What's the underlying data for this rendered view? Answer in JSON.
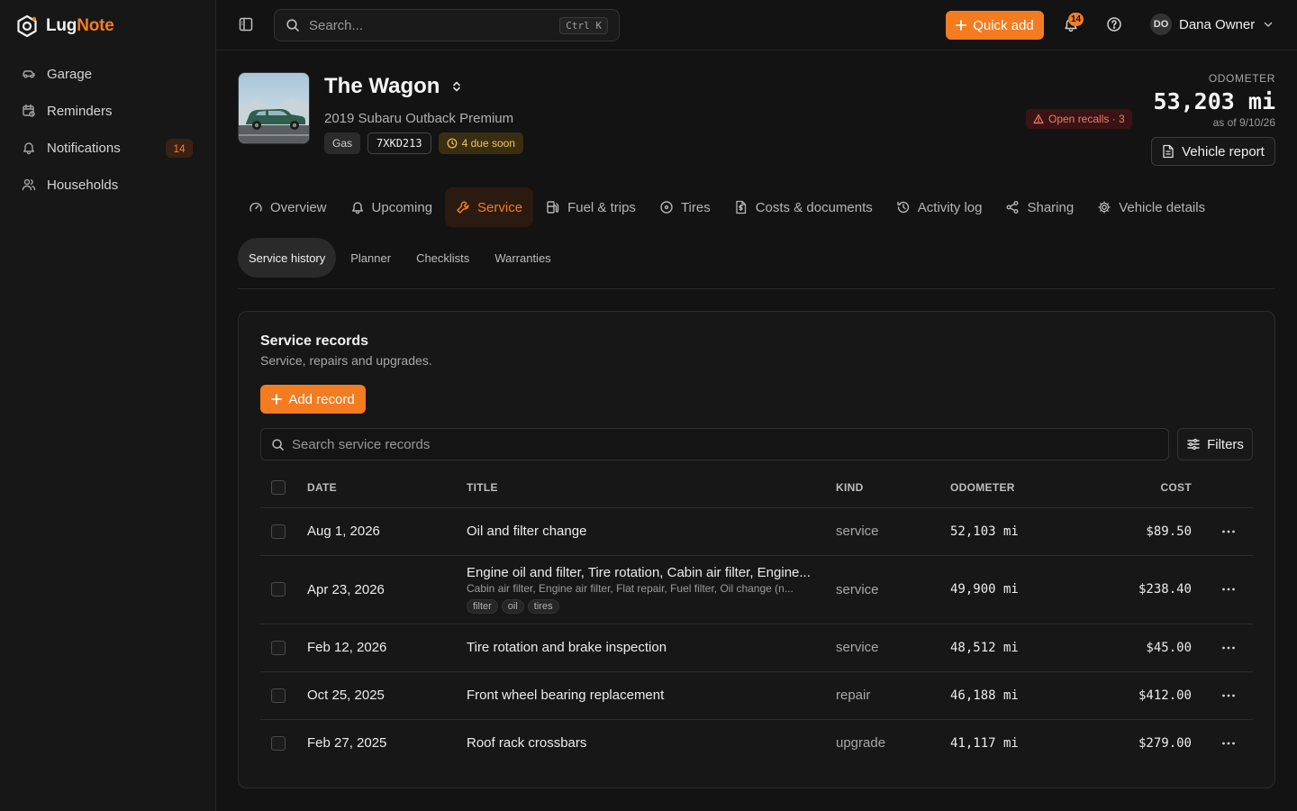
{
  "brand": {
    "name_part1": "Lug",
    "name_part2": "Note"
  },
  "sidebar": {
    "items": [
      {
        "label": "Garage",
        "icon": "car-icon"
      },
      {
        "label": "Reminders",
        "icon": "calendar-clock-icon"
      },
      {
        "label": "Notifications",
        "icon": "bell-icon",
        "badge": "14"
      },
      {
        "label": "Households",
        "icon": "users-icon"
      }
    ]
  },
  "topbar": {
    "search_placeholder": "Search...",
    "search_shortcut": "Ctrl K",
    "quick_add_label": "Quick add",
    "notification_count": "14",
    "user_initials": "DO",
    "user_name": "Dana Owner"
  },
  "vehicle": {
    "name": "The Wagon",
    "subtitle": "2019 Subaru Outback Premium",
    "fuel_chip": "Gas",
    "plate": "7XKD213",
    "due_soon": "4 due soon",
    "recalls": "Open recalls · 3",
    "odometer_label": "ODOMETER",
    "odometer_value": "53,203 mi",
    "odometer_asof": "as of 9/10/26",
    "report_button": "Vehicle report"
  },
  "tabs": [
    {
      "label": "Overview",
      "icon": "gauge-icon"
    },
    {
      "label": "Upcoming",
      "icon": "bell-icon"
    },
    {
      "label": "Service",
      "icon": "wrench-icon",
      "active": true
    },
    {
      "label": "Fuel & trips",
      "icon": "fuel-icon"
    },
    {
      "label": "Tires",
      "icon": "tire-icon"
    },
    {
      "label": "Costs & documents",
      "icon": "document-icon"
    },
    {
      "label": "Activity log",
      "icon": "history-icon"
    },
    {
      "label": "Sharing",
      "icon": "share-icon"
    },
    {
      "label": "Vehicle details",
      "icon": "gear-icon"
    }
  ],
  "subtabs": [
    {
      "label": "Service history",
      "active": true
    },
    {
      "label": "Planner"
    },
    {
      "label": "Checklists"
    },
    {
      "label": "Warranties"
    }
  ],
  "records_card": {
    "title": "Service records",
    "subtitle": "Service, repairs and upgrades.",
    "add_button": "Add record",
    "search_placeholder": "Search service records",
    "filters_button": "Filters",
    "columns": {
      "date": "DATE",
      "title": "TITLE",
      "kind": "KIND",
      "odometer": "ODOMETER",
      "cost": "COST"
    },
    "rows": [
      {
        "date": "Aug 1, 2026",
        "title": "Oil and filter change",
        "kind": "service",
        "odometer": "52,103 mi",
        "cost": "$89.50"
      },
      {
        "date": "Apr 23, 2026",
        "title": "Engine oil and filter, Tire rotation, Cabin air filter, Engine...",
        "description": "Cabin air filter, Engine air filter, Flat repair, Fuel filter, Oil change (n...",
        "tags": [
          "filter",
          "oil",
          "tires"
        ],
        "kind": "service",
        "odometer": "49,900 mi",
        "cost": "$238.40"
      },
      {
        "date": "Feb 12, 2026",
        "title": "Tire rotation and brake inspection",
        "kind": "service",
        "odometer": "48,512 mi",
        "cost": "$45.00"
      },
      {
        "date": "Oct 25, 2025",
        "title": "Front wheel bearing replacement",
        "kind": "repair",
        "odometer": "46,188 mi",
        "cost": "$412.00"
      },
      {
        "date": "Feb 27, 2025",
        "title": "Roof rack crossbars",
        "kind": "upgrade",
        "odometer": "41,117 mi",
        "cost": "$279.00"
      }
    ]
  },
  "colors": {
    "accent": "#f47c20",
    "background": "#131313",
    "sidebar": "#171717",
    "danger": "#f07a6a",
    "warning": "#f1c65a"
  }
}
